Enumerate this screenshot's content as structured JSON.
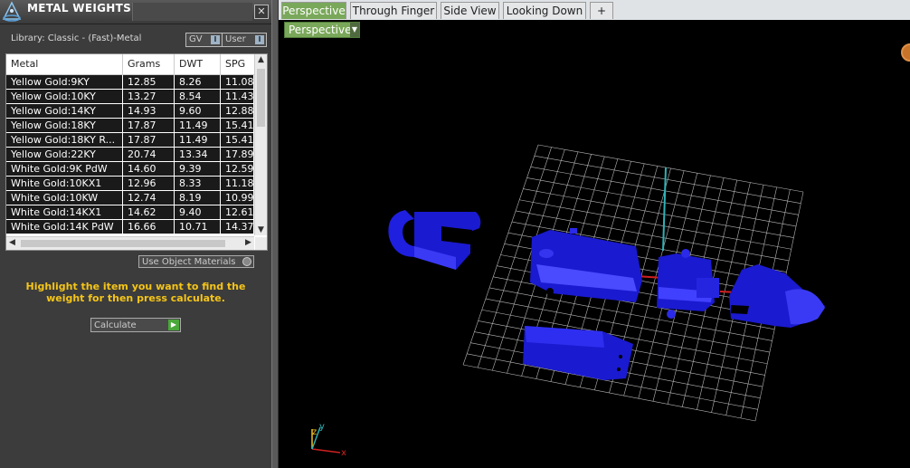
{
  "panel": {
    "title": "METAL WEIGHTS",
    "close_icon": "close-icon",
    "library_label": "Library: Classic - (Fast)-Metal",
    "gv_label": "GV",
    "user_label": "User",
    "toggle_glyph": "I"
  },
  "table": {
    "columns": [
      "Metal",
      "Grams",
      "DWT",
      "SPG"
    ],
    "rows": [
      [
        "Yellow Gold:9KY",
        "12.85",
        "8.26",
        "11.08"
      ],
      [
        "Yellow Gold:10KY",
        "13.27",
        "8.54",
        "11.43"
      ],
      [
        "Yellow Gold:14KY",
        "14.93",
        "9.60",
        "12.88"
      ],
      [
        "Yellow Gold:18KY",
        "17.87",
        "11.49",
        "15.41"
      ],
      [
        "Yellow Gold:18KY R...",
        "17.87",
        "11.49",
        "15.41"
      ],
      [
        "Yellow Gold:22KY",
        "20.74",
        "13.34",
        "17.89"
      ],
      [
        "White Gold:9K PdW",
        "14.60",
        "9.39",
        "12.59"
      ],
      [
        "White Gold:10KX1",
        "12.96",
        "8.33",
        "11.18"
      ],
      [
        "White Gold:10KW",
        "12.74",
        "8.19",
        "10.99"
      ],
      [
        "White Gold:14KX1",
        "14.62",
        "9.40",
        "12.61"
      ],
      [
        "White Gold:14K PdW",
        "16.66",
        "10.71",
        "14.37"
      ]
    ]
  },
  "use_object_materials": "Use Object Materials",
  "instruction": "Highlight the item you want to find the weight for then press calculate.",
  "calculate_label": "Calculate",
  "viewport": {
    "tabs": [
      "Perspective",
      "Through Finger",
      "Side View",
      "Looking Down",
      "+"
    ],
    "active_tab": "Perspective",
    "view_dropdown": "Perspective",
    "axis_labels": {
      "x": "x",
      "y": "y",
      "z": "z"
    }
  },
  "colors": {
    "accent_green": "#7aa85a",
    "model_blue": "#1f1fe0",
    "instruction_yellow": "#f5c518"
  }
}
